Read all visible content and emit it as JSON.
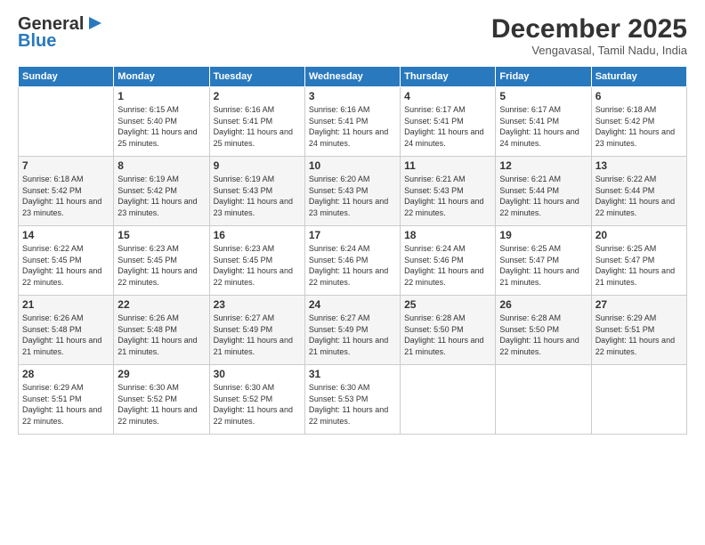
{
  "logo": {
    "line1": "General",
    "line2": "Blue",
    "arrow": "▶"
  },
  "header": {
    "month": "December 2025",
    "location": "Vengavasal, Tamil Nadu, India"
  },
  "weekdays": [
    "Sunday",
    "Monday",
    "Tuesday",
    "Wednesday",
    "Thursday",
    "Friday",
    "Saturday"
  ],
  "weeks": [
    [
      {
        "day": "",
        "sunrise": "",
        "sunset": "",
        "daylight": ""
      },
      {
        "day": "1",
        "sunrise": "Sunrise: 6:15 AM",
        "sunset": "Sunset: 5:40 PM",
        "daylight": "Daylight: 11 hours and 25 minutes."
      },
      {
        "day": "2",
        "sunrise": "Sunrise: 6:16 AM",
        "sunset": "Sunset: 5:41 PM",
        "daylight": "Daylight: 11 hours and 25 minutes."
      },
      {
        "day": "3",
        "sunrise": "Sunrise: 6:16 AM",
        "sunset": "Sunset: 5:41 PM",
        "daylight": "Daylight: 11 hours and 24 minutes."
      },
      {
        "day": "4",
        "sunrise": "Sunrise: 6:17 AM",
        "sunset": "Sunset: 5:41 PM",
        "daylight": "Daylight: 11 hours and 24 minutes."
      },
      {
        "day": "5",
        "sunrise": "Sunrise: 6:17 AM",
        "sunset": "Sunset: 5:41 PM",
        "daylight": "Daylight: 11 hours and 24 minutes."
      },
      {
        "day": "6",
        "sunrise": "Sunrise: 6:18 AM",
        "sunset": "Sunset: 5:42 PM",
        "daylight": "Daylight: 11 hours and 23 minutes."
      }
    ],
    [
      {
        "day": "7",
        "sunrise": "Sunrise: 6:18 AM",
        "sunset": "Sunset: 5:42 PM",
        "daylight": "Daylight: 11 hours and 23 minutes."
      },
      {
        "day": "8",
        "sunrise": "Sunrise: 6:19 AM",
        "sunset": "Sunset: 5:42 PM",
        "daylight": "Daylight: 11 hours and 23 minutes."
      },
      {
        "day": "9",
        "sunrise": "Sunrise: 6:19 AM",
        "sunset": "Sunset: 5:43 PM",
        "daylight": "Daylight: 11 hours and 23 minutes."
      },
      {
        "day": "10",
        "sunrise": "Sunrise: 6:20 AM",
        "sunset": "Sunset: 5:43 PM",
        "daylight": "Daylight: 11 hours and 23 minutes."
      },
      {
        "day": "11",
        "sunrise": "Sunrise: 6:21 AM",
        "sunset": "Sunset: 5:43 PM",
        "daylight": "Daylight: 11 hours and 22 minutes."
      },
      {
        "day": "12",
        "sunrise": "Sunrise: 6:21 AM",
        "sunset": "Sunset: 5:44 PM",
        "daylight": "Daylight: 11 hours and 22 minutes."
      },
      {
        "day": "13",
        "sunrise": "Sunrise: 6:22 AM",
        "sunset": "Sunset: 5:44 PM",
        "daylight": "Daylight: 11 hours and 22 minutes."
      }
    ],
    [
      {
        "day": "14",
        "sunrise": "Sunrise: 6:22 AM",
        "sunset": "Sunset: 5:45 PM",
        "daylight": "Daylight: 11 hours and 22 minutes."
      },
      {
        "day": "15",
        "sunrise": "Sunrise: 6:23 AM",
        "sunset": "Sunset: 5:45 PM",
        "daylight": "Daylight: 11 hours and 22 minutes."
      },
      {
        "day": "16",
        "sunrise": "Sunrise: 6:23 AM",
        "sunset": "Sunset: 5:45 PM",
        "daylight": "Daylight: 11 hours and 22 minutes."
      },
      {
        "day": "17",
        "sunrise": "Sunrise: 6:24 AM",
        "sunset": "Sunset: 5:46 PM",
        "daylight": "Daylight: 11 hours and 22 minutes."
      },
      {
        "day": "18",
        "sunrise": "Sunrise: 6:24 AM",
        "sunset": "Sunset: 5:46 PM",
        "daylight": "Daylight: 11 hours and 22 minutes."
      },
      {
        "day": "19",
        "sunrise": "Sunrise: 6:25 AM",
        "sunset": "Sunset: 5:47 PM",
        "daylight": "Daylight: 11 hours and 21 minutes."
      },
      {
        "day": "20",
        "sunrise": "Sunrise: 6:25 AM",
        "sunset": "Sunset: 5:47 PM",
        "daylight": "Daylight: 11 hours and 21 minutes."
      }
    ],
    [
      {
        "day": "21",
        "sunrise": "Sunrise: 6:26 AM",
        "sunset": "Sunset: 5:48 PM",
        "daylight": "Daylight: 11 hours and 21 minutes."
      },
      {
        "day": "22",
        "sunrise": "Sunrise: 6:26 AM",
        "sunset": "Sunset: 5:48 PM",
        "daylight": "Daylight: 11 hours and 21 minutes."
      },
      {
        "day": "23",
        "sunrise": "Sunrise: 6:27 AM",
        "sunset": "Sunset: 5:49 PM",
        "daylight": "Daylight: 11 hours and 21 minutes."
      },
      {
        "day": "24",
        "sunrise": "Sunrise: 6:27 AM",
        "sunset": "Sunset: 5:49 PM",
        "daylight": "Daylight: 11 hours and 21 minutes."
      },
      {
        "day": "25",
        "sunrise": "Sunrise: 6:28 AM",
        "sunset": "Sunset: 5:50 PM",
        "daylight": "Daylight: 11 hours and 21 minutes."
      },
      {
        "day": "26",
        "sunrise": "Sunrise: 6:28 AM",
        "sunset": "Sunset: 5:50 PM",
        "daylight": "Daylight: 11 hours and 22 minutes."
      },
      {
        "day": "27",
        "sunrise": "Sunrise: 6:29 AM",
        "sunset": "Sunset: 5:51 PM",
        "daylight": "Daylight: 11 hours and 22 minutes."
      }
    ],
    [
      {
        "day": "28",
        "sunrise": "Sunrise: 6:29 AM",
        "sunset": "Sunset: 5:51 PM",
        "daylight": "Daylight: 11 hours and 22 minutes."
      },
      {
        "day": "29",
        "sunrise": "Sunrise: 6:30 AM",
        "sunset": "Sunset: 5:52 PM",
        "daylight": "Daylight: 11 hours and 22 minutes."
      },
      {
        "day": "30",
        "sunrise": "Sunrise: 6:30 AM",
        "sunset": "Sunset: 5:52 PM",
        "daylight": "Daylight: 11 hours and 22 minutes."
      },
      {
        "day": "31",
        "sunrise": "Sunrise: 6:30 AM",
        "sunset": "Sunset: 5:53 PM",
        "daylight": "Daylight: 11 hours and 22 minutes."
      },
      {
        "day": "",
        "sunrise": "",
        "sunset": "",
        "daylight": ""
      },
      {
        "day": "",
        "sunrise": "",
        "sunset": "",
        "daylight": ""
      },
      {
        "day": "",
        "sunrise": "",
        "sunset": "",
        "daylight": ""
      }
    ]
  ]
}
